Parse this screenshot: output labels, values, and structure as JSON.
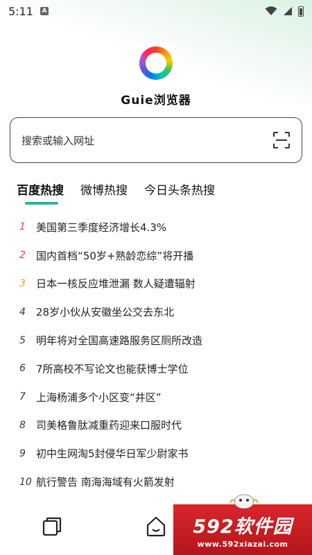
{
  "status_bar": {
    "time": "5:11",
    "notif_badge": "A"
  },
  "app": {
    "title": "Guie浏览器"
  },
  "search": {
    "placeholder": "搜索或输入网址"
  },
  "tabs": [
    {
      "label": "百度热搜",
      "active": true
    },
    {
      "label": "微博热搜",
      "active": false
    },
    {
      "label": "今日头条热搜",
      "active": false
    }
  ],
  "hot_list": [
    {
      "rank": "1",
      "text": "美国第三季度经济增长4.3%"
    },
    {
      "rank": "2",
      "text": "国内首档“50岁+熟龄恋综”将开播"
    },
    {
      "rank": "3",
      "text": "日本一核反应堆泄漏 数人疑遭辐射"
    },
    {
      "rank": "4",
      "text": "28岁小伙从安徽坐公交去东北"
    },
    {
      "rank": "5",
      "text": "明年将对全国高速路服务区厕所改造"
    },
    {
      "rank": "6",
      "text": "7所高校不写论文也能获博士学位"
    },
    {
      "rank": "7",
      "text": "上海杨浦多个小区变“井区”"
    },
    {
      "rank": "8",
      "text": "司美格鲁肽减重药迎来口服时代"
    },
    {
      "rank": "9",
      "text": "初中生网淘5封侵华日军少尉家书"
    },
    {
      "rank": "10",
      "text": "航行警告 南海海域有火箭发射"
    }
  ],
  "colors": {
    "accent": "#2bb3a6",
    "rank_top": "#e8424a",
    "rank_third": "#f0a026",
    "watermark_bg": "#d9262b"
  },
  "icons": {
    "tabs_nav": "tabs-icon",
    "home_nav": "home-icon",
    "scan": "scan-icon"
  },
  "watermark": {
    "main": "592软件园",
    "sub": "www.592xiazai.com"
  }
}
